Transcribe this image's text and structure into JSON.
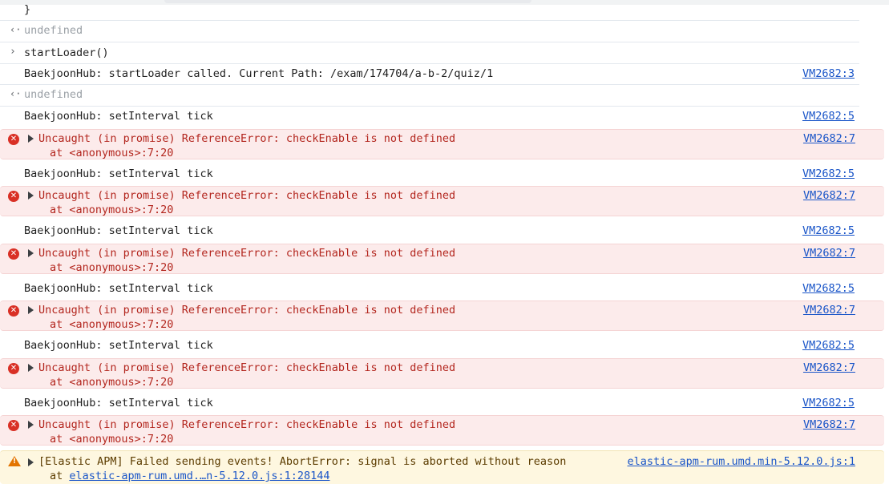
{
  "console": {
    "brace_line": "}",
    "result1": "undefined",
    "input_command": "startLoader()",
    "loader_log": {
      "text": "BaekjoonHub: startLoader called. Current Path: /exam/174704/a-b-2/quiz/1",
      "source": "VM2682:3"
    },
    "result2": "undefined",
    "tick_text": "BaekjoonHub: setInterval tick",
    "tick_source": "VM2682:5",
    "error_text": "Uncaught (in promise) ReferenceError: checkEnable is not defined",
    "error_stack": "at <anonymous>:7:20",
    "error_source": "VM2682:7",
    "warning": {
      "text": "[Elastic APM] Failed sending events! AbortError: signal is aborted without reason",
      "stack_prefix": "at ",
      "stack_link": "elastic-apm-rum.umd.…n-5.12.0.js:1:28144",
      "source": "elastic-apm-rum.umd.min-5.12.0.js:1"
    }
  },
  "icons": {
    "error": "error-circle-icon",
    "warning": "warning-triangle-icon",
    "expand": "expand-triangle-icon",
    "prompt": "chevron-right-icon",
    "result": "return-arrow-icon"
  },
  "colors": {
    "error_bg": "#fcebeb",
    "error_text": "#b3261e",
    "warning_bg": "#fef7e0",
    "link": "#1a55c8"
  }
}
